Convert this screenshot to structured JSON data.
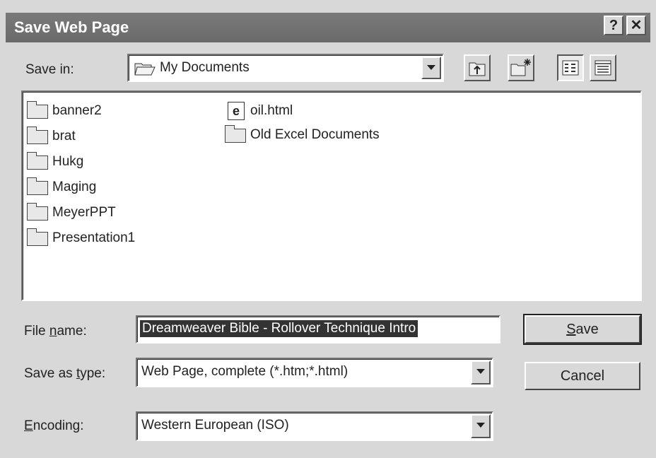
{
  "window": {
    "title": "Save Web Page",
    "help_label": "?",
    "close_label": "✕"
  },
  "toolbar": {
    "save_in_label": "Save in:",
    "save_in_value": "My Documents",
    "buttons": [
      "up-one-level",
      "create-new-folder",
      "list-view",
      "details-view"
    ]
  },
  "files": {
    "folders": [
      "banner2",
      "brat",
      "Hukg",
      "Maging",
      "MeyerPPT",
      "Presentation1"
    ],
    "col2": [
      {
        "name": "oil.html",
        "icon": "html-file-icon"
      },
      {
        "name": "Old Excel Documents",
        "icon": "folder-icon"
      }
    ]
  },
  "form": {
    "file_name_label_pre": "File ",
    "file_name_label_accel": "n",
    "file_name_label_post": "ame:",
    "file_name_value": "Dreamweaver Bible - Rollover Technique Intro",
    "save_type_label_pre": "Save as ",
    "save_type_label_accel": "t",
    "save_type_label_post": "ype:",
    "save_type_value": "Web Page, complete (*.htm;*.html)",
    "encoding_label_accel": "E",
    "encoding_label_post": "ncoding:",
    "encoding_value": "Western European (ISO)"
  },
  "buttons": {
    "save_accel": "S",
    "save_rest": "ave",
    "cancel": "Cancel"
  }
}
